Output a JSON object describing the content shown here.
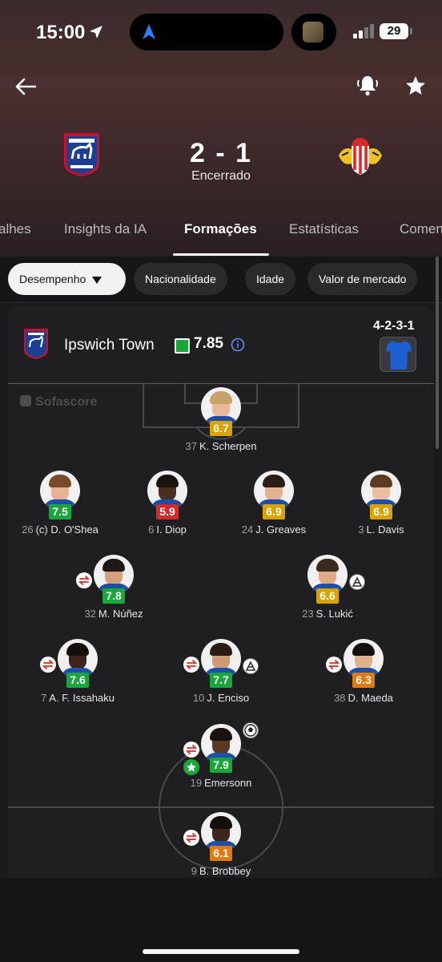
{
  "status_bar": {
    "time": "15:00",
    "battery": "29"
  },
  "match": {
    "home_score": "2",
    "score_separator": "-",
    "away_score": "1",
    "score_text": "2 - 1",
    "status": "Encerrado"
  },
  "tabs": [
    {
      "label": "alhes"
    },
    {
      "label": "Insights da IA"
    },
    {
      "label": "Formações"
    },
    {
      "label": "Estatísticas"
    },
    {
      "label": "Comen"
    }
  ],
  "filters": [
    {
      "label": "Desempenho"
    },
    {
      "label": "Nacionalidade"
    },
    {
      "label": "Idade"
    },
    {
      "label": "Valor de mercado"
    }
  ],
  "team": {
    "name": "Ipswich Town",
    "rating": "7.85",
    "formation": "4-2-3-1"
  },
  "watermark": "Sofascore",
  "colors": {
    "green": "#1aa63b",
    "yellow": "#d9a300",
    "orange": "#e07a12",
    "red": "#d22b2b"
  },
  "players": [
    {
      "number": "37",
      "name": "K. Scherpen",
      "rating": "6.7",
      "rating_color": "yellow"
    },
    {
      "number": "26",
      "name": "(c) D. O'Shea",
      "rating": "7.5",
      "rating_color": "green"
    },
    {
      "number": "6",
      "name": "I. Diop",
      "rating": "5.9",
      "rating_color": "red"
    },
    {
      "number": "24",
      "name": "J. Greaves",
      "rating": "6.9",
      "rating_color": "yellow"
    },
    {
      "number": "3",
      "name": "L. Davis",
      "rating": "6.9",
      "rating_color": "yellow"
    },
    {
      "number": "32",
      "name": "M. Núñez",
      "rating": "7.8",
      "rating_color": "green"
    },
    {
      "number": "23",
      "name": "S. Lukić",
      "rating": "6.6",
      "rating_color": "yellow"
    },
    {
      "number": "7",
      "name": "A. F. Issahaku",
      "rating": "7.6",
      "rating_color": "green"
    },
    {
      "number": "10",
      "name": "J. Enciso",
      "rating": "7.7",
      "rating_color": "green"
    },
    {
      "number": "38",
      "name": "D. Maeda",
      "rating": "6.3",
      "rating_color": "orange"
    },
    {
      "number": "19",
      "name": "Emersonn",
      "rating": "7.9",
      "rating_color": "green"
    },
    {
      "number": "9",
      "name": "B. Brobbey",
      "rating": "6.1",
      "rating_color": "orange"
    }
  ]
}
